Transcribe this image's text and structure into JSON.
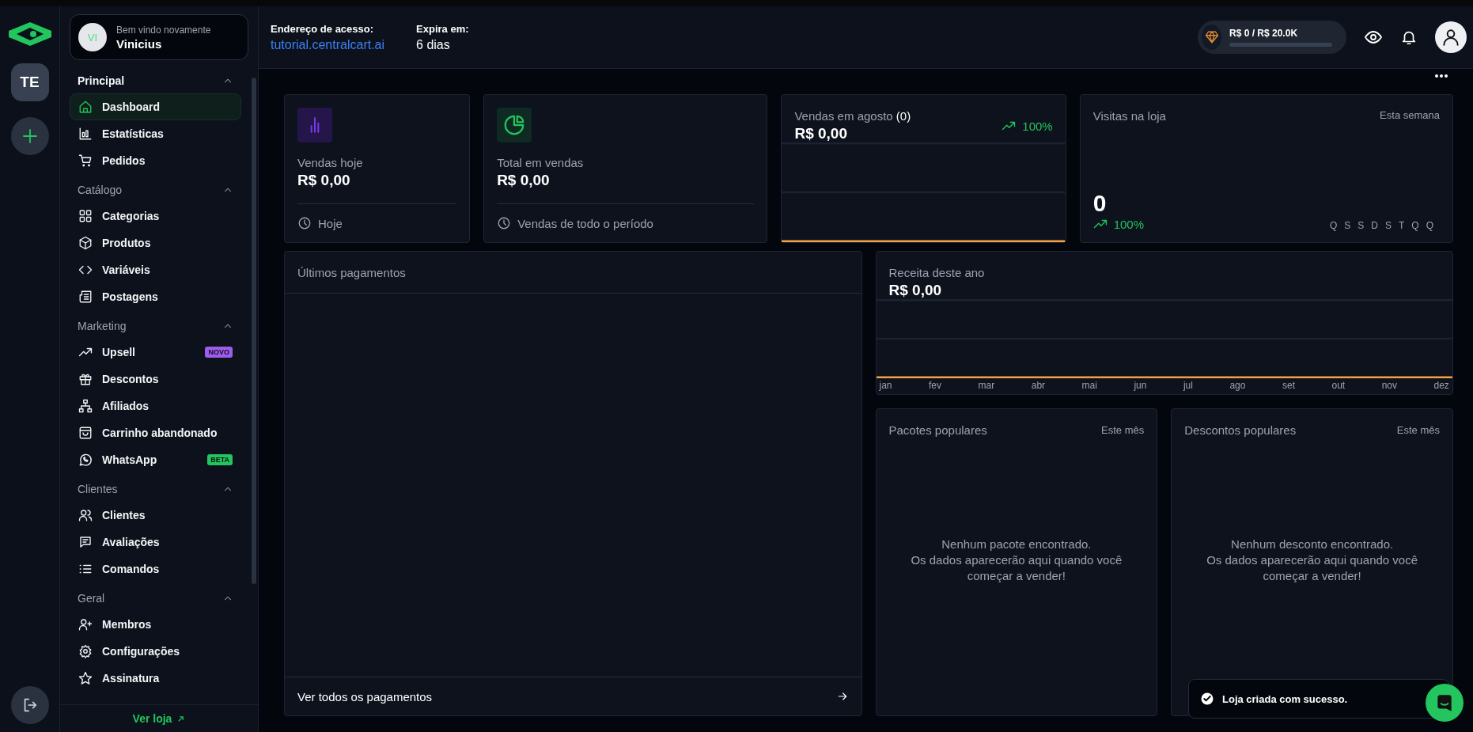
{
  "rail": {
    "workspace": "TE"
  },
  "user": {
    "initials": "VI",
    "greeting": "Bem vindo novamente",
    "name": "Vinicius"
  },
  "sidebar": {
    "sections": [
      {
        "title": "Principal",
        "expanded": true,
        "items": [
          {
            "label": "Dashboard",
            "selected": true
          },
          {
            "label": "Estatísticas",
            "selected": false
          },
          {
            "label": "Pedidos",
            "selected": false
          }
        ]
      },
      {
        "title": "Catálogo",
        "expanded": true,
        "items": [
          {
            "label": "Categorias",
            "selected": false
          },
          {
            "label": "Produtos",
            "selected": false
          },
          {
            "label": "Variáveis",
            "selected": false
          },
          {
            "label": "Postagens",
            "selected": false
          }
        ]
      },
      {
        "title": "Marketing",
        "expanded": true,
        "items": [
          {
            "label": "Upsell",
            "selected": false,
            "badge": {
              "text": "NOVO",
              "color": "#9d5cf0"
            }
          },
          {
            "label": "Descontos",
            "selected": false
          },
          {
            "label": "Afiliados",
            "selected": false
          },
          {
            "label": "Carrinho abandonado",
            "selected": false
          },
          {
            "label": "WhatsApp",
            "selected": false,
            "badge": {
              "text": "BETA",
              "color": "#22c55e"
            }
          }
        ]
      },
      {
        "title": "Clientes",
        "expanded": true,
        "items": [
          {
            "label": "Clientes",
            "selected": false
          },
          {
            "label": "Avaliações",
            "selected": false
          },
          {
            "label": "Comandos",
            "selected": false
          }
        ]
      },
      {
        "title": "Geral",
        "expanded": true,
        "items": [
          {
            "label": "Membros",
            "selected": false
          },
          {
            "label": "Configurações",
            "selected": false
          },
          {
            "label": "Assinatura",
            "selected": false
          }
        ]
      }
    ],
    "footer_link": "Ver loja"
  },
  "header": {
    "access_label": "Endereço de acesso:",
    "access_url": "tutorial.centralcart.ai",
    "expires_label": "Expira em:",
    "expires_value": "6 dias",
    "plan": {
      "text": "R$ 0 / R$ 20.0K",
      "level": 0
    }
  },
  "stats": [
    {
      "kind": "summary",
      "label": "Vendas hoje",
      "value": "R$ 0,00",
      "footer": "Hoje"
    },
    {
      "kind": "summary",
      "label": "Total em vendas",
      "value": "R$ 0,00",
      "footer": "Vendas de todo o período"
    },
    {
      "kind": "trend",
      "label": "Vendas em agosto",
      "count": "(0)",
      "value": "R$ 0,00",
      "change": "100%"
    },
    {
      "kind": "visits",
      "label": "Visitas na loja",
      "period": "Esta semana",
      "value": "0",
      "change": "100%",
      "days": [
        "Q",
        "S",
        "S",
        "D",
        "S",
        "T",
        "Q",
        "Q"
      ]
    }
  ],
  "payments": {
    "title": "Últimos pagamentos",
    "footer_link": "Ver todos os pagamentos"
  },
  "revenue": {
    "title": "Receita deste ano",
    "value": "R$ 0,00",
    "months": [
      "jan",
      "fev",
      "mar",
      "abr",
      "mai",
      "jun",
      "jul",
      "ago",
      "set",
      "out",
      "nov",
      "dez"
    ]
  },
  "popular": [
    {
      "title": "Pacotes populares",
      "period": "Este mês",
      "empty": "Nenhum pacote encontrado.\nOs dados aparecerão aqui quando você\ncomeçar a vender!"
    },
    {
      "title": "Descontos populares",
      "period": "Este mês",
      "empty": "Nenhum desconto encontrado.\nOs dados aparecerão aqui quando você\ncomeçar a vender!"
    }
  ],
  "toast": {
    "message": "Loja criada com sucesso."
  }
}
